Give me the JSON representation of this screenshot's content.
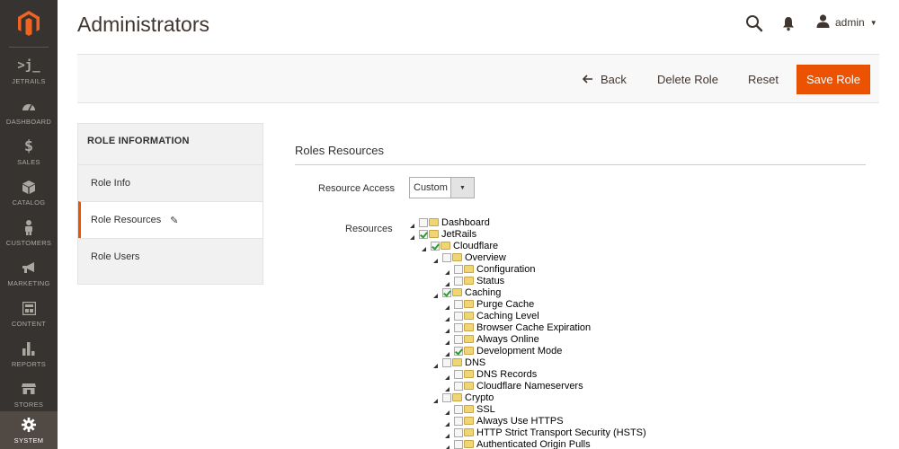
{
  "colors": {
    "sidebar_bg": "#373330",
    "accent": "#eb5202",
    "checked": "#2e9b33"
  },
  "sidebar": {
    "logo_icon": "magento-logo",
    "items": [
      {
        "icon": ">j_",
        "label": "JETRAILS"
      },
      {
        "icon": "dashboard-icon",
        "label": "DASHBOARD"
      },
      {
        "icon": "$",
        "label": "SALES"
      },
      {
        "icon": "catalog-icon",
        "label": "CATALOG"
      },
      {
        "icon": "customers-icon",
        "label": "CUSTOMERS"
      },
      {
        "icon": "marketing-icon",
        "label": "MARKETING"
      },
      {
        "icon": "content-icon",
        "label": "CONTENT"
      },
      {
        "icon": "reports-icon",
        "label": "REPORTS"
      },
      {
        "icon": "stores-icon",
        "label": "STORES"
      },
      {
        "icon": "gear-icon",
        "label": "SYSTEM"
      }
    ]
  },
  "header": {
    "title": "Administrators",
    "user": "admin"
  },
  "actions": {
    "back": "Back",
    "delete": "Delete Role",
    "reset": "Reset",
    "save": "Save Role"
  },
  "tabs": {
    "title": "ROLE INFORMATION",
    "items": [
      "Role Info",
      "Role Resources",
      "Role Users"
    ]
  },
  "resources_section": {
    "title": "Roles Resources",
    "access_label": "Resource Access",
    "access_value": "Custom",
    "resources_label": "Resources"
  },
  "tree": [
    {
      "label": "Dashboard",
      "level": 0,
      "checked": false
    },
    {
      "label": "JetRails",
      "level": 0,
      "checked": true
    },
    {
      "label": "Cloudflare",
      "level": 1,
      "checked": true
    },
    {
      "label": "Overview",
      "level": 2,
      "checked": false
    },
    {
      "label": "Configuration",
      "level": 3,
      "checked": false
    },
    {
      "label": "Status",
      "level": 3,
      "checked": false
    },
    {
      "label": "Caching",
      "level": 2,
      "checked": true
    },
    {
      "label": "Purge Cache",
      "level": 3,
      "checked": false
    },
    {
      "label": "Caching Level",
      "level": 3,
      "checked": false
    },
    {
      "label": "Browser Cache Expiration",
      "level": 3,
      "checked": false
    },
    {
      "label": "Always Online",
      "level": 3,
      "checked": false
    },
    {
      "label": "Development Mode",
      "level": 3,
      "checked": true
    },
    {
      "label": "DNS",
      "level": 2,
      "checked": false
    },
    {
      "label": "DNS Records",
      "level": 3,
      "checked": false
    },
    {
      "label": "Cloudflare Nameservers",
      "level": 3,
      "checked": false
    },
    {
      "label": "Crypto",
      "level": 2,
      "checked": false
    },
    {
      "label": "SSL",
      "level": 3,
      "checked": false
    },
    {
      "label": "Always Use HTTPS",
      "level": 3,
      "checked": false
    },
    {
      "label": "HTTP Strict Transport Security (HSTS)",
      "level": 3,
      "checked": false
    },
    {
      "label": "Authenticated Origin Pulls",
      "level": 3,
      "checked": false
    }
  ]
}
